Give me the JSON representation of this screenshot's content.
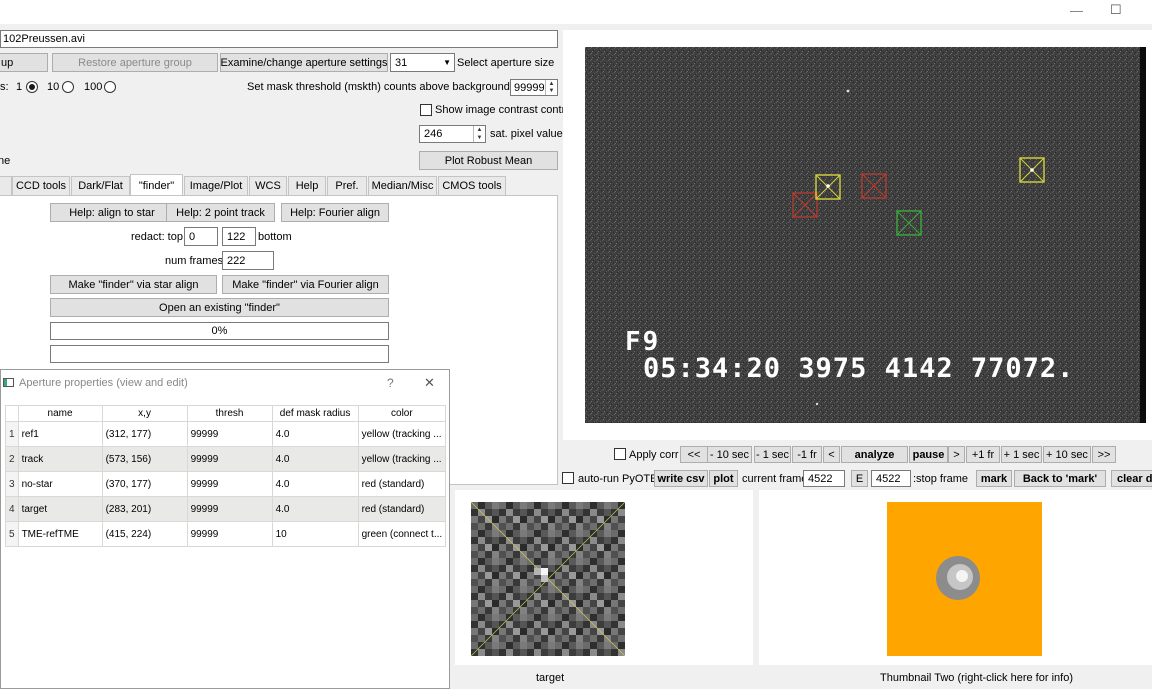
{
  "window": {
    "minimize_glyph": "—",
    "maximize_glyph": "☐"
  },
  "file": {
    "name": "102Preussen.avi"
  },
  "aperture_controls": {
    "up_label": "up",
    "restore_label": "Restore aperture group",
    "examine_label": "Examine/change aperture settings",
    "aperture_size_value": "31",
    "select_size_label": "Select aperture size",
    "radio_prefix": "s:",
    "radio_options": [
      "1",
      "10",
      "100"
    ],
    "radio_selected": "1",
    "mask_threshold_label": "Set mask threshold (mskth) counts above background (bkavg)",
    "mask_threshold_value": "99999",
    "contrast_label": "Show image contrast control",
    "sat_value": "246",
    "sat_label": "sat. pixel value",
    "robust_mean_label": "Plot Robust Mean",
    "left_cut_label": "ne"
  },
  "tabs": [
    "CCD tools",
    "Dark/Flat",
    "\"finder\"",
    "Image/Plot",
    "WCS",
    "Help",
    "Pref.",
    "Median/Misc",
    "CMOS tools"
  ],
  "active_tab": "\"finder\"",
  "finder": {
    "help_align": "Help: align to star",
    "help_two_point": "Help: 2 point track",
    "help_fourier": "Help: Fourier align",
    "redact_label": "redact: top",
    "redact_top": "0",
    "redact_bottom": "122",
    "bottom_label": "bottom",
    "num_frames_label": "num frames:",
    "num_frames": "222",
    "make_star_align": "Make \"finder\" via star align",
    "make_fourier": "Make \"finder\" via Fourier align",
    "open_existing": "Open an existing  \"finder\"",
    "progress_text": "0%",
    "progress_value": 0
  },
  "aperture_dialog": {
    "title": "Aperture properties (view and edit)",
    "help_glyph": "?",
    "close_glyph": "✕",
    "columns": [
      "name",
      "x,y",
      "thresh",
      "def mask radius",
      "color"
    ],
    "rows": [
      {
        "idx": "1",
        "name": "ref1",
        "xy": "(312, 177)",
        "thresh": "99999",
        "radius": "4.0",
        "color": "yellow (tracking ..."
      },
      {
        "idx": "2",
        "name": "track",
        "xy": "(573, 156)",
        "thresh": "99999",
        "radius": "4.0",
        "color": "yellow (tracking ..."
      },
      {
        "idx": "3",
        "name": "no-star",
        "xy": "(370, 177)",
        "thresh": "99999",
        "radius": "4.0",
        "color": "red (standard)"
      },
      {
        "idx": "4",
        "name": "target",
        "xy": "(283, 201)",
        "thresh": "99999",
        "radius": "4.0",
        "color": "red (standard)"
      },
      {
        "idx": "5",
        "name": "TME-refTME",
        "xy": "(415, 224)",
        "thresh": "99999",
        "radius": "10",
        "color": "green (connect t..."
      }
    ]
  },
  "video": {
    "overlay_line1": "F9",
    "overlay_line2": "05:34:20 3975 4142 77072.",
    "aperture_box_colors": {
      "yellow": "#d4d43a",
      "red": "#c0392b",
      "green": "#3aa83a"
    }
  },
  "playback": {
    "apply_corr": "Apply corr",
    "buttons": [
      "<<",
      "- 10 sec",
      "- 1 sec",
      "-1 fr",
      "<",
      "analyze",
      "pause",
      ">",
      "+1 fr",
      "+ 1 sec",
      "+ 10 sec",
      ">>"
    ],
    "auto_run": "auto-run PyOTE",
    "write_csv": "write csv",
    "plot": "plot",
    "current_frame_label": "current frame:",
    "current_frame": "4522",
    "e_label": "E",
    "stop_frame": "4522",
    "stop_frame_label": ":stop frame",
    "mark": "mark",
    "back_to_mark": "Back to 'mark'",
    "clear": "clear da"
  },
  "thumbnails": {
    "one_caption": "target",
    "two_caption": "Thumbnail Two (right-click here for info)",
    "two_bg": "#ffa500"
  }
}
